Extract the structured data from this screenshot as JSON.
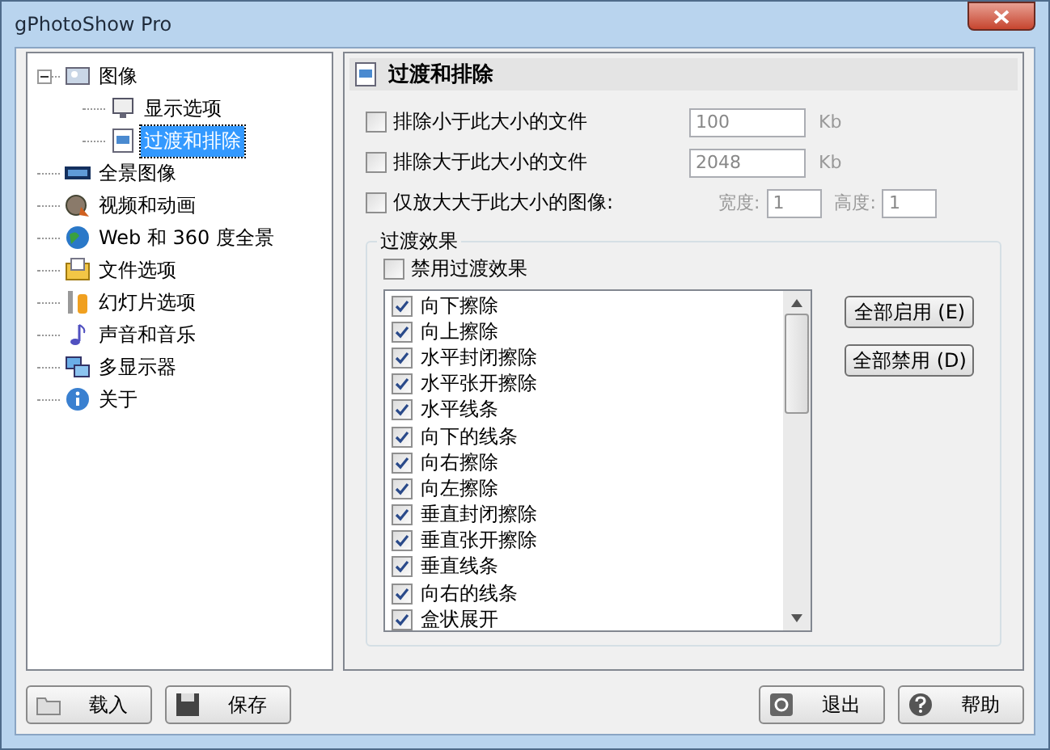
{
  "window": {
    "title": "gPhotoShow Pro"
  },
  "tree": {
    "items": [
      {
        "label": "图像",
        "kind": "image",
        "selected": false,
        "expanded": true,
        "children": [
          {
            "label": "显示选项",
            "kind": "display",
            "selected": false
          },
          {
            "label": "过渡和排除",
            "kind": "transition",
            "selected": true
          }
        ]
      },
      {
        "label": "全景图像",
        "kind": "panorama",
        "selected": false
      },
      {
        "label": "视频和动画",
        "kind": "video",
        "selected": false
      },
      {
        "label": "Web 和 360 度全景",
        "kind": "web",
        "selected": false
      },
      {
        "label": "文件选项",
        "kind": "file",
        "selected": false
      },
      {
        "label": "幻灯片选项",
        "kind": "slideshow",
        "selected": false
      },
      {
        "label": "声音和音乐",
        "kind": "sound",
        "selected": false
      },
      {
        "label": "多显示器",
        "kind": "monitor",
        "selected": false
      },
      {
        "label": "关于",
        "kind": "about",
        "selected": false
      }
    ]
  },
  "panel": {
    "title": "过渡和排除"
  },
  "options": [
    {
      "kind": "size",
      "label": "排除小于此大小的文件",
      "checked": false,
      "value": "100",
      "unit": "Kb",
      "disabled": true
    },
    {
      "kind": "size",
      "label": "排除大于此大小的文件",
      "checked": false,
      "value": "2048",
      "unit": "Kb",
      "disabled": true
    },
    {
      "kind": "dimensions",
      "label": "仅放大大于此大小的图像:",
      "checked": false,
      "width_label": "宽度:",
      "width_value": "1",
      "height_label": "高度:",
      "height_value": "1",
      "disabled": true
    }
  ],
  "transitions": {
    "title": "过渡效果",
    "disable_option": {
      "label": "禁用过渡效果",
      "checked": false
    },
    "effects": [
      {
        "label": "向下擦除",
        "checked": true
      },
      {
        "label": "向上擦除",
        "checked": true
      },
      {
        "label": "水平封闭擦除",
        "checked": true
      },
      {
        "label": "水平张开擦除",
        "checked": true
      },
      {
        "label": "水平线条",
        "checked": true
      },
      {
        "label": "向下的线条",
        "checked": true
      },
      {
        "label": "向右擦除",
        "checked": true
      },
      {
        "label": "向左擦除",
        "checked": true
      },
      {
        "label": "垂直封闭擦除",
        "checked": true
      },
      {
        "label": "垂直张开擦除",
        "checked": true
      },
      {
        "label": "垂直线条",
        "checked": true
      },
      {
        "label": "向右的线条",
        "checked": true
      },
      {
        "label": "盒状展开",
        "checked": true
      }
    ],
    "buttons": [
      "全部启用 (E)",
      "全部禁用 (D)"
    ]
  },
  "footer": {
    "left": [
      {
        "kind": "load",
        "label": "载入"
      },
      {
        "kind": "save",
        "label": "保存"
      }
    ],
    "right": [
      {
        "kind": "exit",
        "label": "退出"
      },
      {
        "kind": "help",
        "label": "帮助"
      }
    ]
  }
}
